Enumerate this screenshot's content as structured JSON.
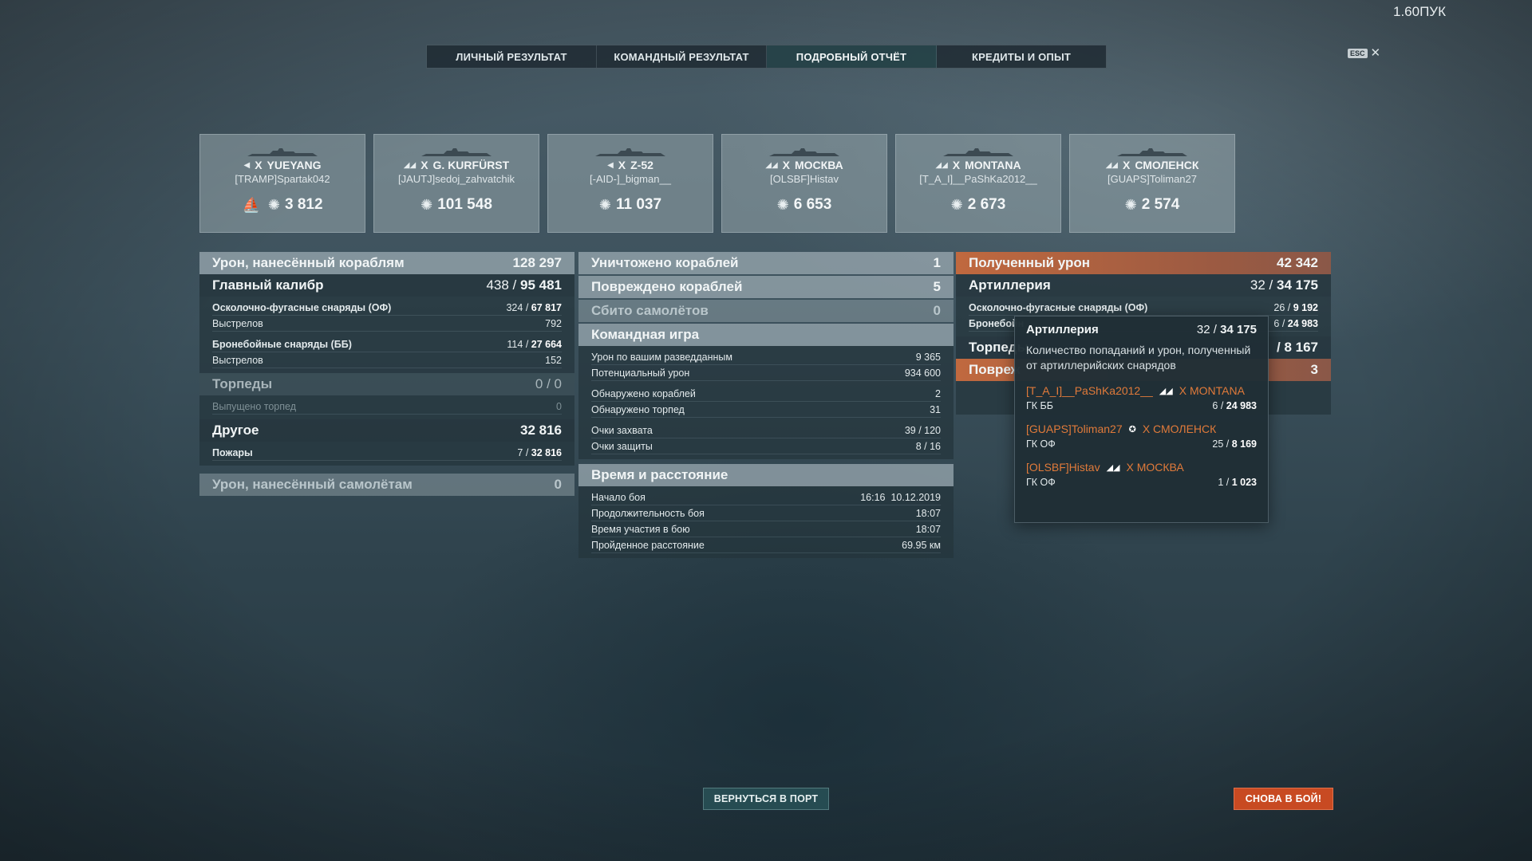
{
  "player_name": "1.60ПУК",
  "esc": {
    "key": "ESC",
    "close": "✕"
  },
  "tabs": [
    {
      "label": "ЛИЧНЫЙ РЕЗУЛЬТАТ",
      "active": false
    },
    {
      "label": "КОМАНДНЫЙ РЕЗУЛЬТАТ",
      "active": false
    },
    {
      "label": "ПОДРОБНЫЙ ОТЧЁТ",
      "active": true
    },
    {
      "label": "КРЕДИТЫ И ОПЫТ",
      "active": false
    }
  ],
  "ships": [
    {
      "tier": "X",
      "name": "YUEYANG",
      "player": "[TRAMP]Spartak042",
      "damage": "3 812",
      "sunk": true
    },
    {
      "tier": "X",
      "name": "G. KURFÜRST",
      "player": "[JAUTJ]sedoj_zahvatchik",
      "damage": "101 548",
      "sunk": false
    },
    {
      "tier": "X",
      "name": "Z-52",
      "player": "[-AID-]_bigman__",
      "damage": "11 037",
      "sunk": false
    },
    {
      "tier": "X",
      "name": "МОСКВА",
      "player": "[OLSBF]Histav",
      "damage": "6 653",
      "sunk": false
    },
    {
      "tier": "X",
      "name": "MONTANA",
      "player": "[T_A_I]__PaShKa2012__",
      "damage": "2 673",
      "sunk": false
    },
    {
      "tier": "X",
      "name": "СМОЛЕНСК",
      "player": "[GUAPS]Toliman27",
      "damage": "2 574",
      "sunk": false
    }
  ],
  "damage_dealt": {
    "title": "Урон, нанесённый кораблям",
    "total": "128 297",
    "main_battery": {
      "label": "Главный калибр",
      "hits": "438",
      "damage": "95 481"
    },
    "he": {
      "label": "Осколочно-фугасные снаряды (ОФ)",
      "hits": "324",
      "damage": "67 817",
      "shots_label": "Выстрелов",
      "shots": "792"
    },
    "ap": {
      "label": "Бронебойные снаряды (ББ)",
      "hits": "114",
      "damage": "27 664",
      "shots_label": "Выстрелов",
      "shots": "152"
    },
    "torpedoes": {
      "label": "Торпеды",
      "hits": "0",
      "damage": "0",
      "launched_label": "Выпущено торпед",
      "launched": "0"
    },
    "other": {
      "label": "Другое",
      "value": "32 816",
      "fires_label": "Пожары",
      "fires": "7",
      "fires_damage": "32 816"
    },
    "aircraft": {
      "label": "Урон, нанесённый самолётам",
      "value": "0"
    }
  },
  "team": {
    "destroyed": {
      "label": "Уничтожено кораблей",
      "value": "1"
    },
    "damaged": {
      "label": "Повреждено кораблей",
      "value": "5"
    },
    "planes": {
      "label": "Сбито самолётов",
      "value": "0"
    },
    "team_play": {
      "label": "Командная игра",
      "rows": [
        {
          "label": "Урон по вашим разведданным",
          "value": "9 365"
        },
        {
          "label": "Потенциальный урон",
          "value": "934 600"
        },
        {
          "label": "Обнаружено кораблей",
          "value": "2"
        },
        {
          "label": "Обнаружено торпед",
          "value": "31"
        },
        {
          "label": "Очки захвата",
          "value": "39 / 120"
        },
        {
          "label": "Очки защиты",
          "value": "8 / 16"
        }
      ]
    },
    "time": {
      "label": "Время и расстояние",
      "start_label": "Начало боя",
      "start_time": "16:16",
      "start_date": "10.12.2019",
      "duration_label": "Продолжительность боя",
      "duration": "18:07",
      "participation_label": "Время участия в бою",
      "participation": "18:07",
      "distance_label": "Пройденное расстояние",
      "distance": "69.95 км"
    }
  },
  "received": {
    "title": "Полученный урон",
    "total": "42 342",
    "artillery": {
      "label": "Артиллерия",
      "hits": "32",
      "damage": "34 175"
    },
    "he_partial": {
      "label": "Осколочно-фугасные снаряды (ОФ)",
      "hits": "26",
      "damage": "9 192"
    },
    "ap_partial": {
      "label": "Бронебойн",
      "hits": "6",
      "damage": "24 983"
    },
    "torp_partial": {
      "label": "Торпеды",
      "value": "/ 8 167"
    },
    "damaged_partial": {
      "label": "Повреж",
      "value": "3"
    }
  },
  "tooltip": {
    "title": "Артиллерия",
    "hits": "32",
    "damage": "34 175",
    "desc": "Количество попаданий и урон, полученный от артиллерийских снарядов",
    "items": [
      {
        "player": "[T_A_I]__PaShKa2012__",
        "ship": "X MONTANA",
        "ammo": "ГК ББ",
        "hits": "6",
        "damage": "24 983"
      },
      {
        "player": "[GUAPS]Toliman27",
        "ship": "X СМОЛЕНСК",
        "ammo": "ГК ОФ",
        "hits": "25",
        "damage": "8 169"
      },
      {
        "player": "[OLSBF]Histav",
        "ship": "X МОСКВА",
        "ammo": "ГК ОФ",
        "hits": "1",
        "damage": "1 023"
      }
    ]
  },
  "buttons": {
    "port": "ВЕРНУТЬСЯ В ПОРТ",
    "battle": "СНОВА В БОЙ!"
  },
  "colors": {
    "accent_orange": "#e07a3a",
    "battle_button": "#c84a22",
    "received_header": "#c0693f"
  }
}
